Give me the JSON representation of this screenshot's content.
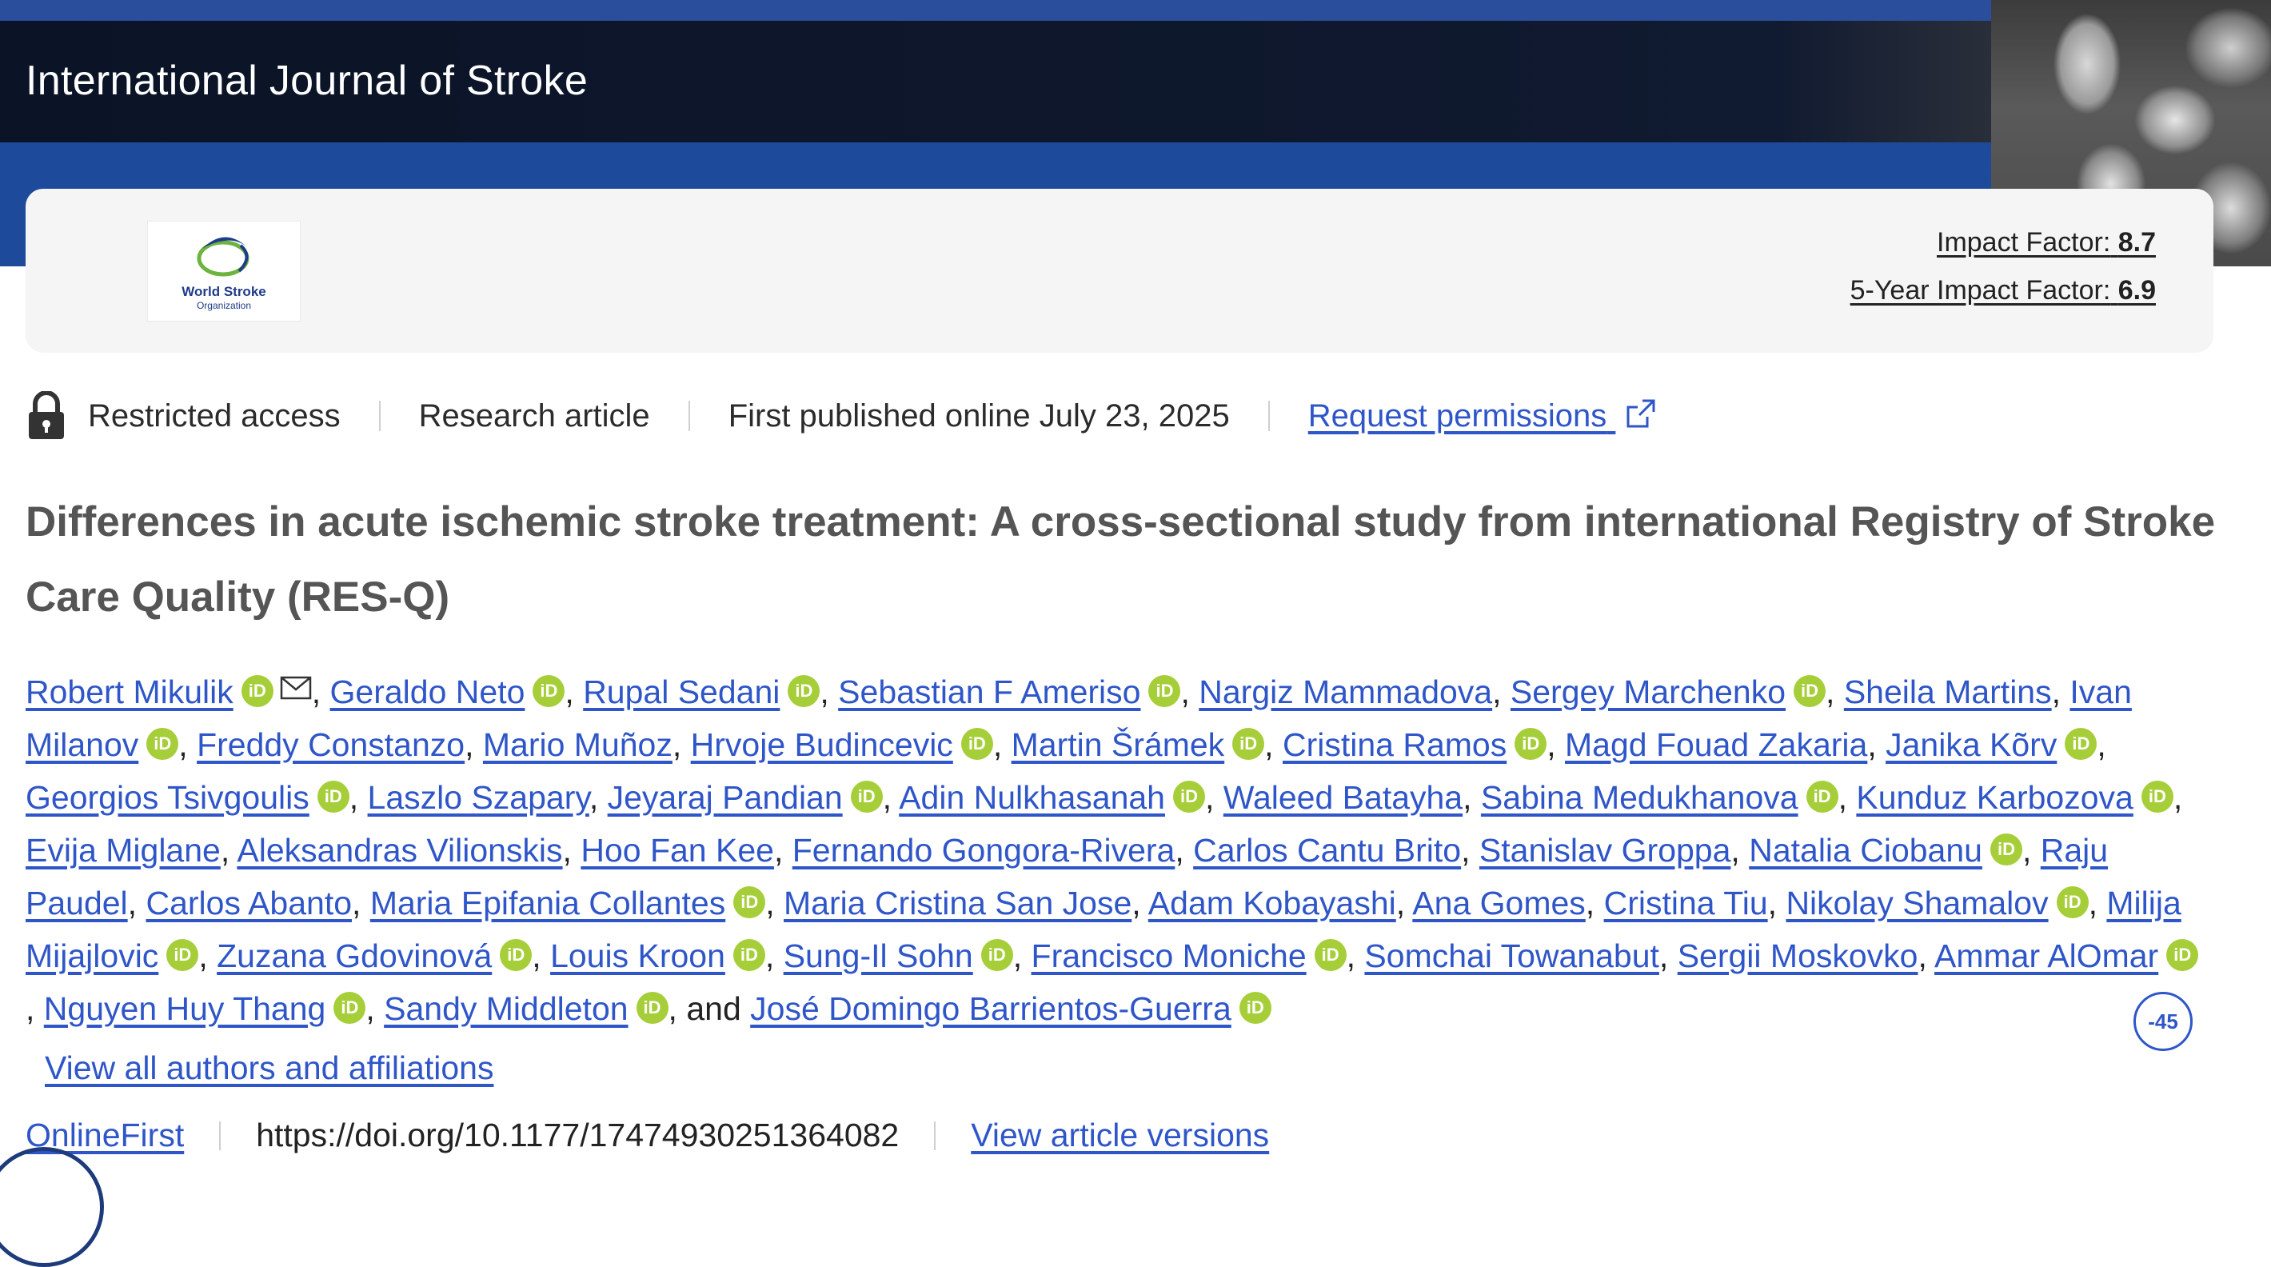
{
  "journal": {
    "name": "International Journal of Stroke",
    "logo_line1": "World Stroke",
    "logo_line2": "Organization",
    "impact_factor_label": "Impact Factor:",
    "impact_factor_value": "8.7",
    "five_year_label": "5-Year Impact Factor:",
    "five_year_value": "6.9"
  },
  "meta": {
    "access": "Restricted access",
    "type": "Research article",
    "published": "First published online July 23, 2025",
    "permissions": "Request permissions"
  },
  "article": {
    "title": "Differences in acute ischemic stroke treatment: A cross-sectional study from international Registry of Stroke Care Quality (RES-Q)"
  },
  "authors": [
    {
      "name": "Robert Mikulik",
      "orcid": true,
      "mail": true
    },
    {
      "name": "Geraldo Neto",
      "orcid": true
    },
    {
      "name": "Rupal Sedani",
      "orcid": true
    },
    {
      "name": "Sebastian F Ameriso",
      "orcid": true
    },
    {
      "name": "Nargiz Mammadova",
      "orcid": false
    },
    {
      "name": "Sergey Marchenko",
      "orcid": true
    },
    {
      "name": "Sheila Martins",
      "orcid": false
    },
    {
      "name": "Ivan Milanov",
      "orcid": true
    },
    {
      "name": "Freddy Constanzo",
      "orcid": false
    },
    {
      "name": "Mario Muñoz",
      "orcid": false
    },
    {
      "name": "Hrvoje Budincevic",
      "orcid": true
    },
    {
      "name": "Martin Šrámek",
      "orcid": true
    },
    {
      "name": "Cristina Ramos",
      "orcid": true
    },
    {
      "name": "Magd Fouad Zakaria",
      "orcid": false
    },
    {
      "name": "Janika Kõrv",
      "orcid": true
    },
    {
      "name": "Georgios Tsivgoulis",
      "orcid": true
    },
    {
      "name": "Laszlo Szapary",
      "orcid": false
    },
    {
      "name": "Jeyaraj Pandian",
      "orcid": true
    },
    {
      "name": "Adin Nulkhasanah",
      "orcid": true
    },
    {
      "name": "Waleed Batayha",
      "orcid": false
    },
    {
      "name": "Sabina Medukhanova",
      "orcid": true
    },
    {
      "name": "Kunduz Karbozova",
      "orcid": true
    },
    {
      "name": "Evija Miglane",
      "orcid": false
    },
    {
      "name": "Aleksandras Vilionskis",
      "orcid": false
    },
    {
      "name": "Hoo Fan Kee",
      "orcid": false
    },
    {
      "name": "Fernando Gongora-Rivera",
      "orcid": false
    },
    {
      "name": "Carlos Cantu Brito",
      "orcid": false
    },
    {
      "name": "Stanislav Groppa",
      "orcid": false
    },
    {
      "name": "Natalia Ciobanu",
      "orcid": true
    },
    {
      "name": "Raju Paudel",
      "orcid": false
    },
    {
      "name": "Carlos Abanto",
      "orcid": false
    },
    {
      "name": "Maria Epifania Collantes",
      "orcid": true
    },
    {
      "name": "Maria Cristina San Jose",
      "orcid": false
    },
    {
      "name": "Adam Kobayashi",
      "orcid": false
    },
    {
      "name": "Ana Gomes",
      "orcid": false
    },
    {
      "name": "Cristina Tiu",
      "orcid": false
    },
    {
      "name": "Nikolay Shamalov",
      "orcid": true
    },
    {
      "name": "Milija Mijajlovic",
      "orcid": true
    },
    {
      "name": "Zuzana Gdovinová",
      "orcid": true
    },
    {
      "name": "Louis Kroon",
      "orcid": true
    },
    {
      "name": "Sung-Il Sohn",
      "orcid": true
    },
    {
      "name": "Francisco Moniche",
      "orcid": true
    },
    {
      "name": "Somchai Towanabut",
      "orcid": false
    },
    {
      "name": "Sergii Moskovko",
      "orcid": false
    },
    {
      "name": "Ammar AlOmar",
      "orcid": true
    },
    {
      "name": "Nguyen Huy Thang",
      "orcid": true
    },
    {
      "name": "Sandy Middleton",
      "orcid": true
    },
    {
      "name": "José Domingo Barrientos-Guerra",
      "orcid": true
    }
  ],
  "authors_conjunction": "and",
  "orcid_label": "iD",
  "collapse_label": "-45",
  "view_all": "View all authors and affiliations",
  "footer": {
    "status": "OnlineFirst",
    "doi": "https://doi.org/10.1177/17474930251364082",
    "versions": "View article versions"
  },
  "colors": {
    "banner": "#0b1326",
    "band": "#1d4a9b",
    "link": "#2f56c9",
    "orcid": "#a6ce39"
  }
}
